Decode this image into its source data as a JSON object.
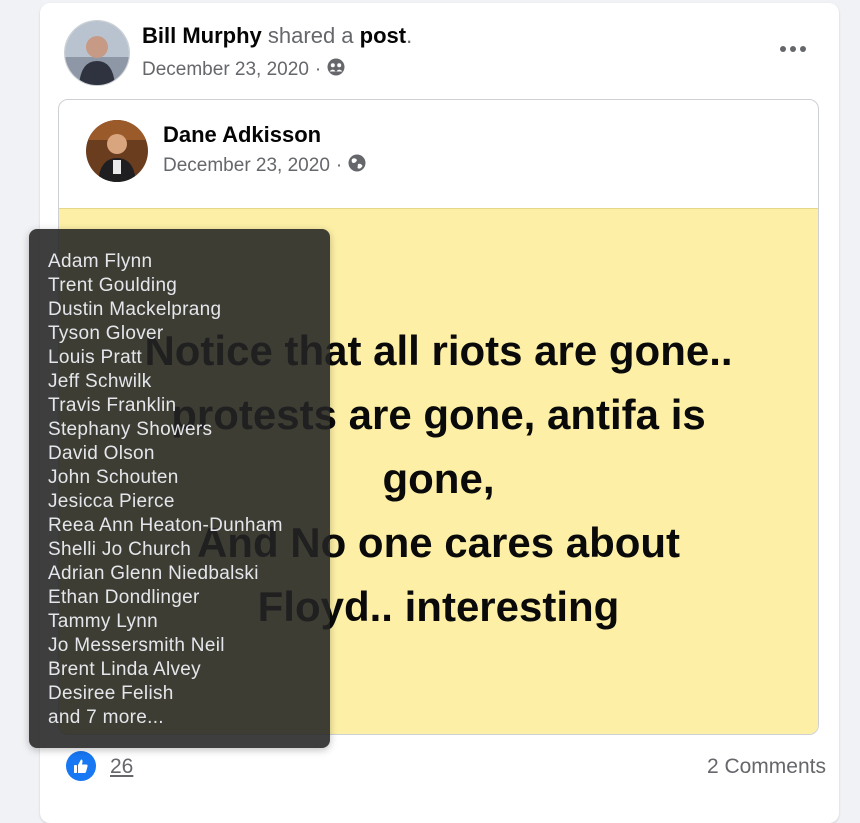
{
  "share_header": {
    "author": "Bill Murphy",
    "action": "shared a",
    "object": "post",
    "period": ".",
    "date": "December 23, 2020",
    "separator": "·",
    "privacy_icon": "friends-icon"
  },
  "shared_post": {
    "author": "Dane Adkisson",
    "date": "December 23, 2020",
    "separator": "·",
    "privacy_icon": "globe-icon",
    "status_lines": [
      "Notice that all riots are gone..",
      "protests are gone, antifa is",
      "gone,",
      "And No one cares about",
      "Floyd.. interesting"
    ],
    "background_color": "#fdf0a6"
  },
  "reactions": {
    "like_count": "26",
    "comments": "2 Comments",
    "icon": "thumbs-up-icon"
  },
  "tooltip": {
    "names": [
      "Adam Flynn",
      "Trent Goulding",
      "Dustin Mackelprang",
      "Tyson Glover",
      "Louis Pratt",
      "Jeff Schwilk",
      "Travis Franklin",
      "Stephany Showers",
      "David Olson",
      "John Schouten",
      "Jesicca Pierce",
      "Reea Ann Heaton-Dunham",
      "Shelli Jo Church",
      "Adrian Glenn Niedbalski",
      "Ethan Dondlinger",
      "Tammy Lynn",
      "Jo Messersmith Neil",
      "Brent Linda Alvey",
      "Desiree Felish",
      "and 7 more..."
    ]
  },
  "colors": {
    "accent": "#1877f2",
    "muted_text": "#65676b"
  }
}
